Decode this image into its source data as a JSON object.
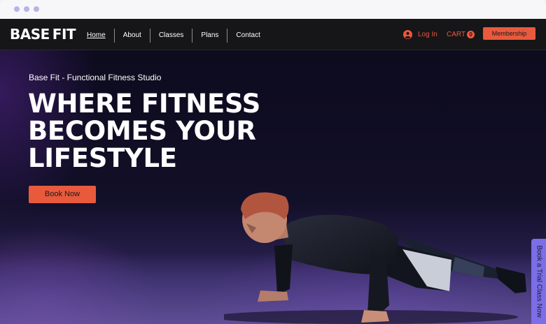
{
  "brand": {
    "logo_base": "BASE",
    "logo_fit": "FIT"
  },
  "nav": {
    "items": [
      "Home",
      "About",
      "Classes",
      "Plans",
      "Contact"
    ],
    "active": "Home"
  },
  "header": {
    "login_label": "Log In",
    "cart_label": "CART",
    "cart_count": "0",
    "membership_label": "Membership"
  },
  "hero": {
    "eyebrow": "Base Fit - Functional Fitness Studio",
    "headline_lines": [
      "WHERE FITNESS",
      "BECOMES YOUR",
      "LIFESTYLE"
    ],
    "cta_label": "Book Now"
  },
  "side_tab": {
    "label": "Book a Trial Class Now"
  },
  "colors": {
    "accent": "#e95a3c",
    "header_bg": "#161618",
    "trial_tab": "#7b6ee6",
    "window_dots": "#b7b3e8"
  },
  "icons": {
    "login": "user-avatar-icon"
  }
}
